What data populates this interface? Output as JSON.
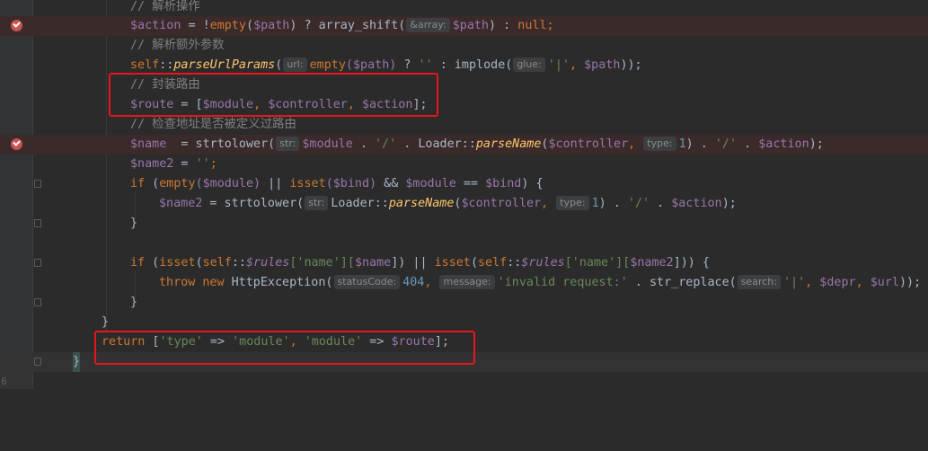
{
  "gutter": {
    "line_numbers": [
      "",
      "",
      "",
      "",
      "",
      "",
      "",
      "",
      "",
      "",
      "",
      "",
      "",
      "",
      "",
      "",
      "",
      "",
      "6"
    ]
  },
  "code": {
    "l1_comment": "// 解析操作",
    "l2": {
      "var": "$action",
      "eq": " = !",
      "fn": "empty",
      "open": "(",
      "arg": "$path",
      "mid": ") ? ",
      "fn2": "array_shift(",
      "hint": "&array:",
      "arg2": "$path",
      "end": ") : ",
      "null": "null",
      "semi": ";"
    },
    "l3_comment": "// 解析额外参数",
    "l4": {
      "self": "self",
      "sep": "::",
      "method": "parseUrlParams",
      "open": "(",
      "hint": "url:",
      "fn": "empty",
      "arg": "($path)",
      "q": " ? ",
      "s": "''",
      "c": " : implode(",
      "hint2": "glue:",
      "s2": "'|'",
      "comma": ", ",
      "arg2": "$path",
      "end": "));"
    },
    "l5_comment": "// 封装路由",
    "l6": {
      "var": "$route",
      "eq": " = [",
      "a": "$module",
      "b": "$controller",
      "c": "$action",
      "comma": ", ",
      "end": "];"
    },
    "l7_comment": "// 检查地址是否被定义过路由",
    "l8": {
      "var": "$name",
      "eq": "  = strtolower(",
      "hint": "str:",
      "a": "$module",
      "dot": " . ",
      "s1": "'/'",
      "cls": "Loader",
      "sep": "::",
      "method": "parseName",
      "open": "(",
      "b": "$controller",
      "comma": ", ",
      "hint2": "type:",
      "n": "1",
      "close": ")",
      "c": "$action",
      "end": ");"
    },
    "l9": {
      "var": "$name2",
      "eq": " = ",
      "s": "''",
      "end": ";"
    },
    "l10": {
      "if": "if",
      "open": " (",
      "fn": "empty",
      "a": "($module)",
      "or": " || ",
      "isset": "isset",
      "b": "($bind)",
      "and": " && ",
      "m": "$module",
      "eqeq": " == ",
      "bind": "$bind",
      "end": ") {"
    },
    "l11": {
      "var": "$name2",
      "eq": " = strtolower(",
      "hint": "str:",
      "cls": "Loader",
      "sep": "::",
      "method": "parseName",
      "open": "(",
      "b": "$controller",
      "comma": ", ",
      "hint2": "type:",
      "n": "1",
      "close": ")",
      "dot": " . ",
      "s": "'/'",
      "c": "$action",
      "end": ");"
    },
    "l12": "}",
    "l14": {
      "if": "if",
      "open": " (",
      "isset": "isset",
      "p1": "(",
      "self": "self",
      "sep": "::",
      "rules": "$rules",
      "k": "['name'][",
      "name": "$name",
      "k2": "]) || ",
      "isset2": "isset",
      "k3": "['name'][",
      "name2": "$name2",
      "end": "])) {"
    },
    "l15": {
      "throw": "throw",
      "new": "new",
      "cls": "HttpException(",
      "hint": "statusCode:",
      "n": "404",
      "comma": ", ",
      "hint2": "message:",
      "s": "'invalid request:'",
      "dot": " . str_replace(",
      "hint3": "search:",
      "s2": "'|'",
      "depr": "$depr",
      "url": "$url",
      "end": "));"
    },
    "l16": "}",
    "l17": "}",
    "l18": {
      "ret": "return",
      "open": " [",
      "k1": "'type'",
      "arrow": " => ",
      "v1": "'module'",
      "comma": ", ",
      "k2": "'module'",
      "v2": "$route",
      "end": "];"
    },
    "l19": "}"
  },
  "colors": {
    "background": "#2b2b2b",
    "keyword": "#cc7832",
    "variable": "#9876aa",
    "string": "#6a8759",
    "comment": "#808080",
    "annotation_box": "#e8161c"
  }
}
